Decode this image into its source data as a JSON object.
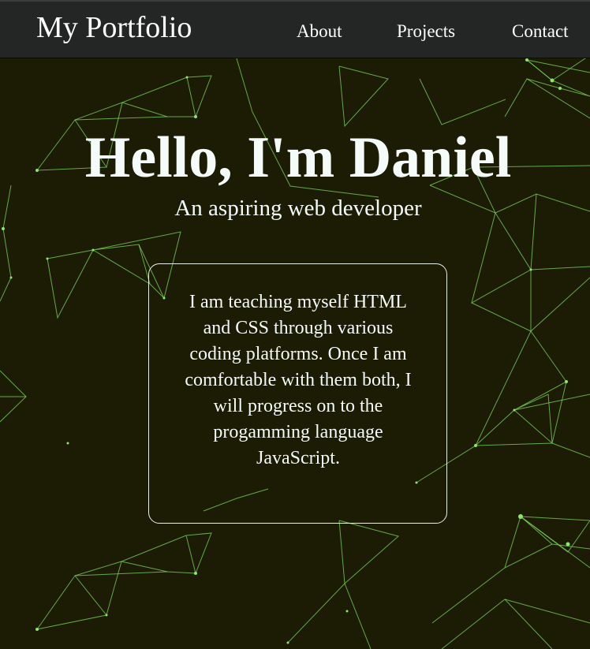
{
  "navbar": {
    "brand": "My Portfolio",
    "links": [
      "About",
      "Projects",
      "Contact"
    ]
  },
  "hero": {
    "title": "Hello, I'm Daniel",
    "subtitle": "An aspiring web developer"
  },
  "about": {
    "text": "I am teaching myself HTML and CSS through various coding platforms. Once I am comfortable with them both, I will progress on to the progamming language JavaScript."
  },
  "colors": {
    "background": "#1c1c04",
    "navbar": "#232624",
    "accent": "#7ee05a",
    "text": "#f4fbf9"
  }
}
